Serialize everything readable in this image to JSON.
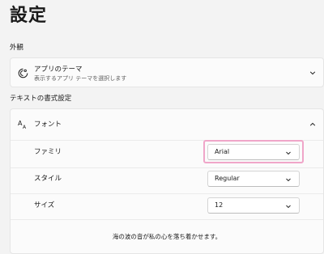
{
  "page": {
    "title": "設定"
  },
  "appearance": {
    "section_label": "外観",
    "theme": {
      "title": "アプリのテーマ",
      "subtitle": "表示するアプリ テーマを選択します",
      "icon": "brush-icon",
      "expanded": false
    }
  },
  "text_format": {
    "section_label": "テキストの書式設定",
    "font": {
      "title": "フォント",
      "icon": "font-size-icon",
      "expanded": true,
      "fields": {
        "family": {
          "label": "ファミリ",
          "value": "Arial",
          "focused": true
        },
        "style": {
          "label": "スタイル",
          "value": "Regular"
        },
        "size": {
          "label": "サイズ",
          "value": "12"
        }
      },
      "preview_text": "海の波の音が私の心を落ち着かせます。"
    }
  },
  "colors": {
    "focus_ring": "#f0a6c9",
    "background": "#f3f3f3",
    "card": "#fbfbfb"
  }
}
